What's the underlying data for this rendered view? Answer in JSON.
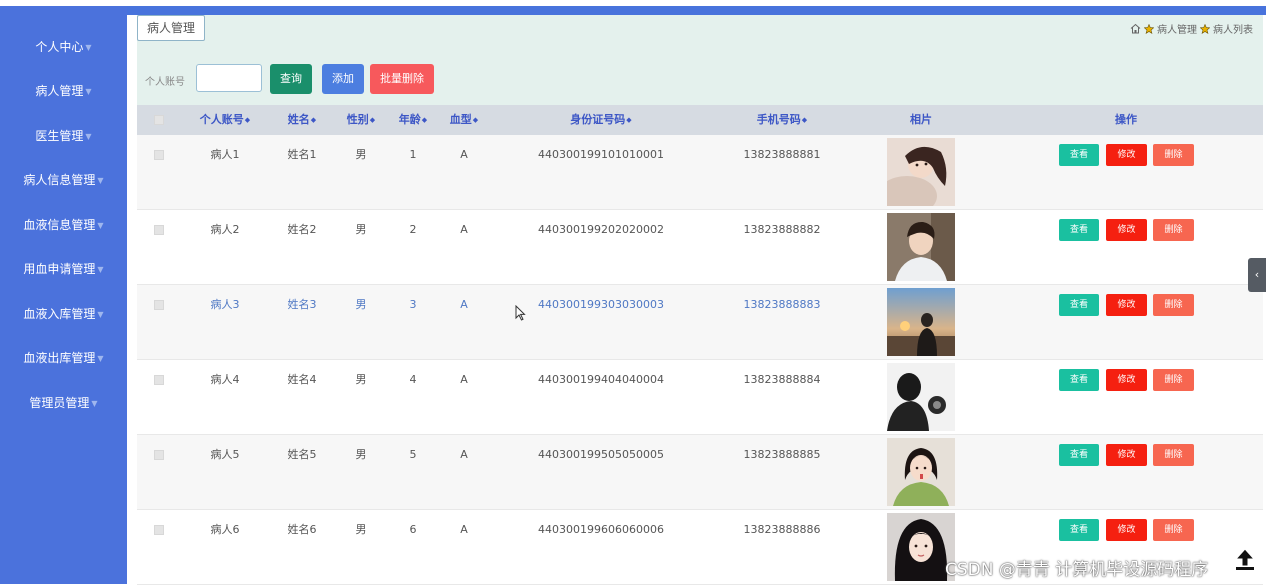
{
  "sidebar": {
    "items": [
      {
        "label": "个人中心"
      },
      {
        "label": "病人管理"
      },
      {
        "label": "医生管理"
      },
      {
        "label": "病人信息管理"
      },
      {
        "label": "血液信息管理"
      },
      {
        "label": "用血申请管理"
      },
      {
        "label": "血液入库管理"
      },
      {
        "label": "血液出库管理"
      },
      {
        "label": "管理员管理"
      }
    ]
  },
  "header": {
    "title": "病人管理",
    "breadcrumb": [
      "病人管理",
      "病人列表"
    ]
  },
  "search": {
    "label": "个人账号",
    "value": "",
    "query_label": "查询",
    "add_label": "添加",
    "batch_delete_label": "批量删除"
  },
  "table": {
    "columns": [
      "个人账号",
      "姓名",
      "性别",
      "年龄",
      "血型",
      "身份证号码",
      "手机号码",
      "相片",
      "操作"
    ],
    "rows": [
      {
        "account": "病人1",
        "name": "姓名1",
        "gender": "男",
        "age": "1",
        "blood": "A",
        "id_card": "440300199101010001",
        "phone": "13823888881",
        "photo": "photo-girl-lying"
      },
      {
        "account": "病人2",
        "name": "姓名2",
        "gender": "男",
        "age": "2",
        "blood": "A",
        "id_card": "440300199202020002",
        "phone": "13823888882",
        "photo": "photo-boy-white-jacket"
      },
      {
        "account": "病人3",
        "name": "姓名3",
        "gender": "男",
        "age": "3",
        "blood": "A",
        "id_card": "440300199303030003",
        "phone": "13823888883",
        "photo": "photo-sunset-figure"
      },
      {
        "account": "病人4",
        "name": "姓名4",
        "gender": "男",
        "age": "4",
        "blood": "A",
        "id_card": "440300199404040004",
        "phone": "13823888884",
        "photo": "photo-bw-silhouette"
      },
      {
        "account": "病人5",
        "name": "姓名5",
        "gender": "男",
        "age": "5",
        "blood": "A",
        "id_card": "440300199505050005",
        "phone": "13823888885",
        "photo": "photo-girl-green-sweater"
      },
      {
        "account": "病人6",
        "name": "姓名6",
        "gender": "男",
        "age": "6",
        "blood": "A",
        "id_card": "440300199606060006",
        "phone": "13823888886",
        "photo": "photo-girl-dark-hair"
      }
    ],
    "actions": {
      "view": "查看",
      "edit": "修改",
      "delete": "删除"
    }
  },
  "side_tab_icon": "chevron-left-icon",
  "back_to_top_icon": "arrow-up-icon",
  "watermark": "CSDN @青青  计算机毕设源码程序",
  "colors": {
    "sidebar": "#4b72dc",
    "header": "#e4f1ed",
    "query": "#1a8f6b",
    "add": "#4c7ee0",
    "batch_delete": "#f7595c",
    "view": "#1ac0a0",
    "edit": "#f52010",
    "delete": "#f76650"
  }
}
